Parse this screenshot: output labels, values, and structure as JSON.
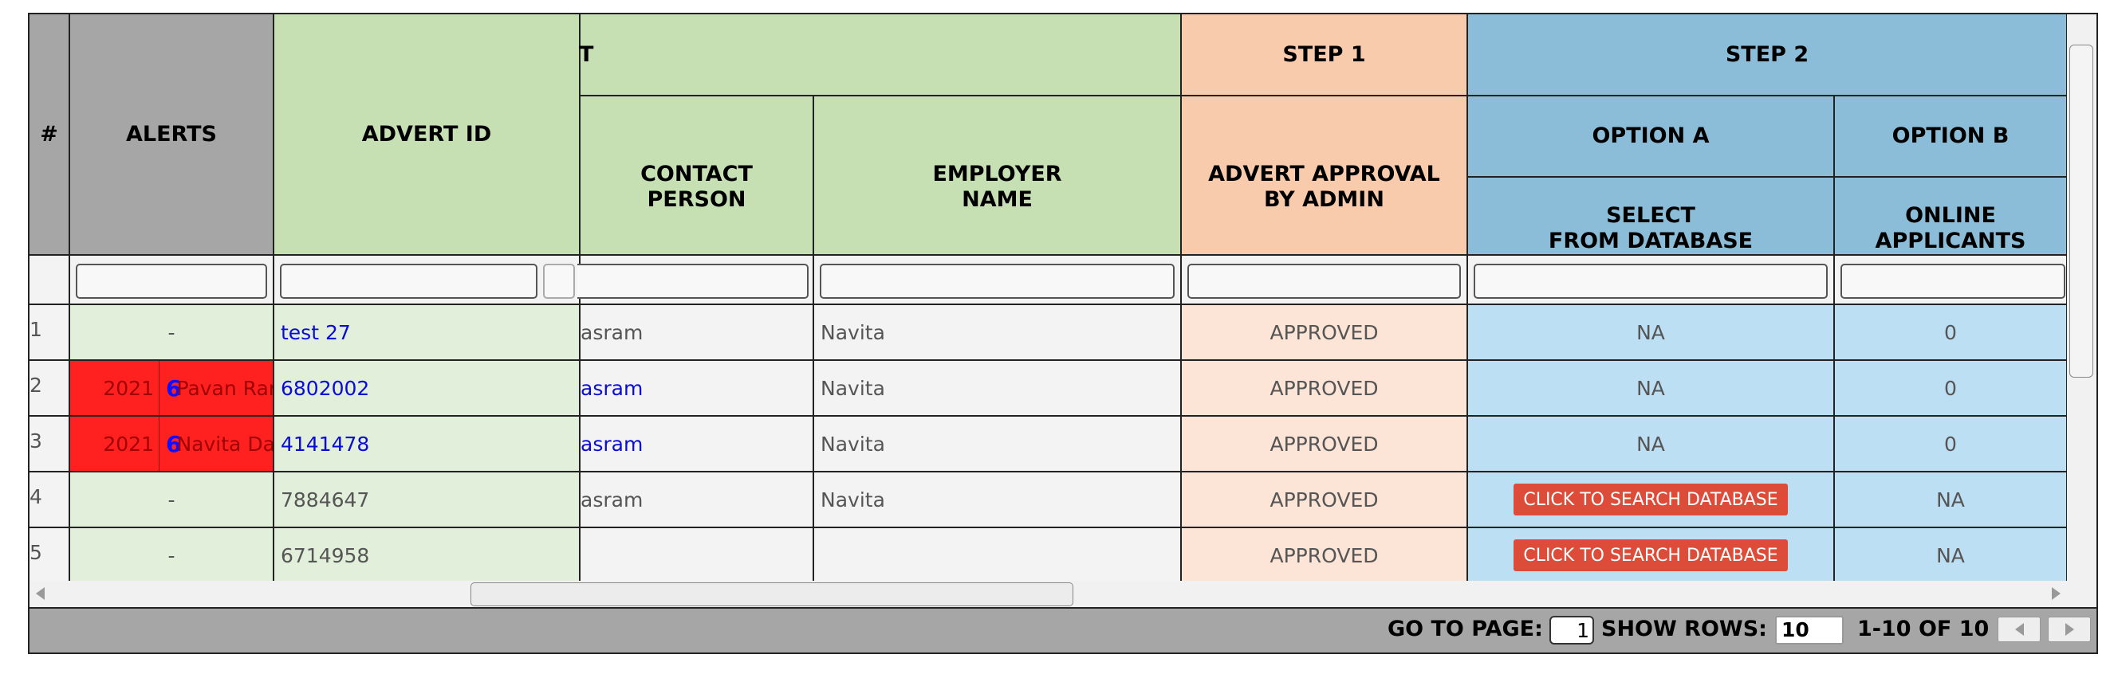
{
  "header": {
    "num": "#",
    "alerts": "ALERTS",
    "advert_id": "ADVERT ID",
    "group_partial": "T",
    "step1": "STEP 1",
    "step2": "STEP 2",
    "option_a": "OPTION A",
    "option_b": "OPTION B",
    "contact_person_l1": "CONTACT",
    "contact_person_l2": "PERSON",
    "employer_name_l1": "EMPLOYER",
    "employer_name_l2": "NAME",
    "approval_l1": "ADVERT APPROVAL",
    "approval_l2": "BY ADMIN",
    "select_db_l1": "SELECT",
    "select_db_l2": "FROM DATABASE",
    "online_l1": "ONLINE",
    "online_l2": "APPLICANTS"
  },
  "rows": [
    {
      "num": "1",
      "alert": "-",
      "advert_id": "test 27",
      "contact": "asram",
      "employer": "Navita",
      "approval": "APPROVED",
      "opt_a": "NA",
      "opt_b": "0"
    },
    {
      "num": "2",
      "alert_date": "2021",
      "alert_count": "6",
      "alert_name": "Pavan Ram",
      "advert_id": "6802002",
      "contact": "asram",
      "employer": "Navita",
      "approval": "APPROVED",
      "opt_a": "NA",
      "opt_b": "0"
    },
    {
      "num": "3",
      "alert_date": "2021",
      "alert_count": "6",
      "alert_name": "Navita Das",
      "advert_id": "4141478",
      "contact": "asram",
      "employer": "Navita",
      "approval": "APPROVED",
      "opt_a": "NA",
      "opt_b": "0"
    },
    {
      "num": "4",
      "alert": "-",
      "advert_id": "7884647",
      "contact": "asram",
      "employer": "Navita",
      "approval": "APPROVED",
      "opt_a": "CLICK TO SEARCH DATABASE",
      "opt_b": "NA"
    },
    {
      "num": "5",
      "alert": "-",
      "advert_id": "6714958",
      "contact": "",
      "employer": "",
      "approval": "APPROVED",
      "opt_a": "CLICK TO SEARCH DATABASE",
      "opt_b": "NA"
    }
  ],
  "footer": {
    "go_to_page_label": "GO TO PAGE:",
    "page_value": "1",
    "show_rows_label": "SHOW ROWS:",
    "rows_value": "10",
    "range_text": "1-10 OF 10"
  },
  "icons": {
    "prev": "chevron-left-icon",
    "next": "chevron-right-icon"
  }
}
